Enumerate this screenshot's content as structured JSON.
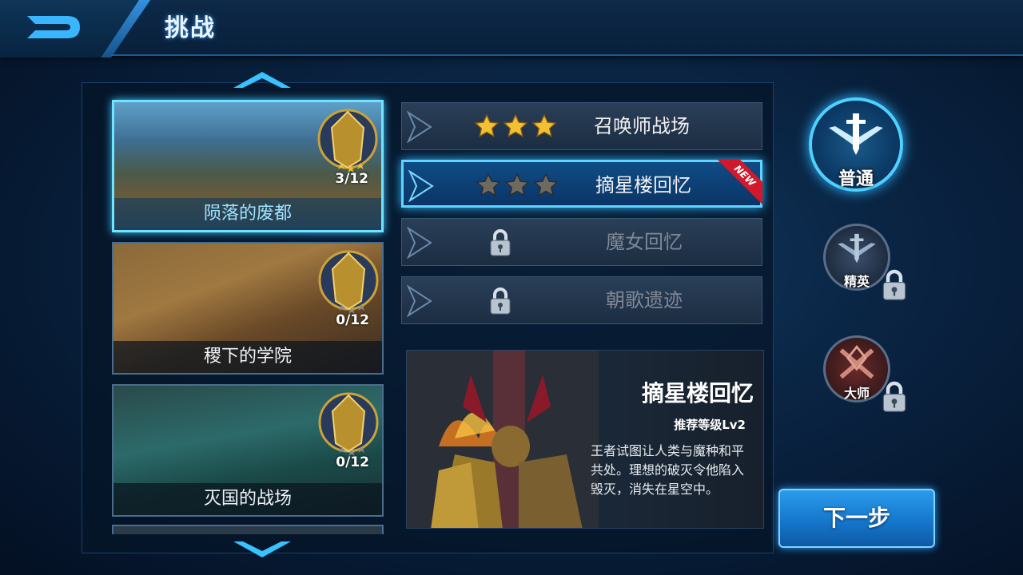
{
  "header": {
    "title": "挑战",
    "back_icon": "back-arrow-icon"
  },
  "maps": [
    {
      "name": "陨落的废都",
      "progress": "3/12",
      "selected": true
    },
    {
      "name": "稷下的学院",
      "progress": "0/12",
      "selected": false
    },
    {
      "name": "灭国的战场",
      "progress": "0/12",
      "selected": false
    }
  ],
  "levels": [
    {
      "name": "召唤师战场",
      "stars_earned": 3,
      "stars_total": 3,
      "locked": false,
      "selected": false
    },
    {
      "name": "摘星楼回忆",
      "stars_earned": 0,
      "stars_total": 3,
      "locked": false,
      "selected": true,
      "badge": "NEW"
    },
    {
      "name": "魔女回忆",
      "locked": true,
      "selected": false
    },
    {
      "name": "朝歌遗迹",
      "locked": true,
      "selected": false
    }
  ],
  "detail": {
    "title": "摘星楼回忆",
    "recommend": "推荐等级Lv2",
    "description": "王者试图让人类与魔种和平共处。理想的破灭令他陷入毁灭，消失在星空中。"
  },
  "difficulty": [
    {
      "label": "普通",
      "selected": true,
      "locked": false
    },
    {
      "label": "精英",
      "selected": false,
      "locked": true
    },
    {
      "label": "大师",
      "selected": false,
      "locked": true
    }
  ],
  "actions": {
    "next_label": "下一步"
  },
  "colors": {
    "accent": "#5fd4ff",
    "star_gold": "#f2c033",
    "new_badge": "#d2182a",
    "button_blue": "#1577cc"
  }
}
